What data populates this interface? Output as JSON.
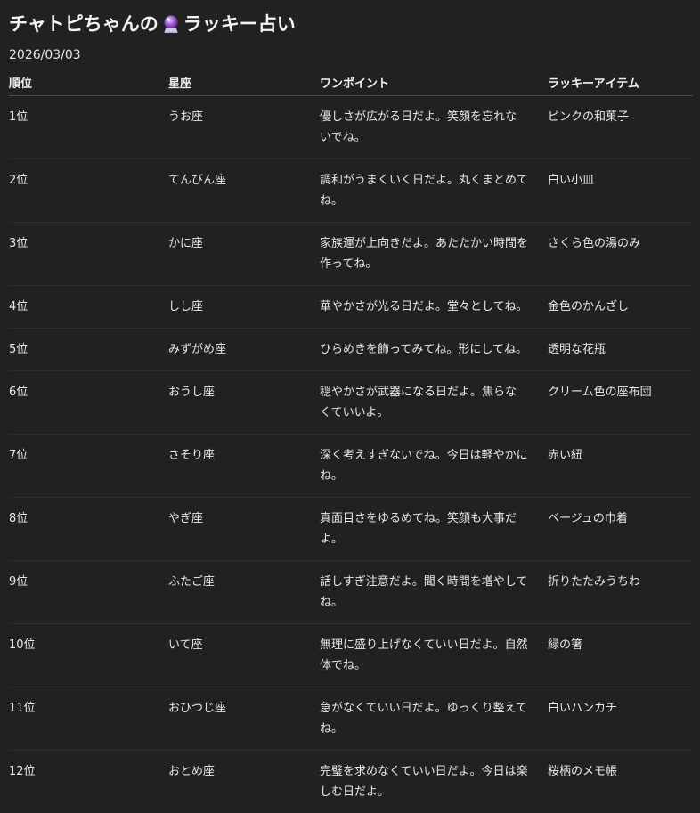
{
  "title": {
    "prefix": "チャトピちゃんの",
    "icon": "crystal-ball-icon",
    "suffix": "ラッキー占い"
  },
  "date": "2026/03/03",
  "table": {
    "headers": [
      "順位",
      "星座",
      "ワンポイント",
      "ラッキーアイテム"
    ],
    "rows": [
      {
        "rank": "1位",
        "sign": "うお座",
        "tip": "優しさが広がる日だよ。笑顔を忘れないでね。",
        "item": "ピンクの和菓子"
      },
      {
        "rank": "2位",
        "sign": "てんびん座",
        "tip": "調和がうまくいく日だよ。丸くまとめてね。",
        "item": "白い小皿"
      },
      {
        "rank": "3位",
        "sign": "かに座",
        "tip": "家族運が上向きだよ。あたたかい時間を作ってね。",
        "item": "さくら色の湯のみ"
      },
      {
        "rank": "4位",
        "sign": "しし座",
        "tip": "華やかさが光る日だよ。堂々としてね。",
        "item": "金色のかんざし"
      },
      {
        "rank": "5位",
        "sign": "みずがめ座",
        "tip": "ひらめきを飾ってみてね。形にしてね。",
        "item": "透明な花瓶"
      },
      {
        "rank": "6位",
        "sign": "おうし座",
        "tip": "穏やかさが武器になる日だよ。焦らなくていいよ。",
        "item": "クリーム色の座布団"
      },
      {
        "rank": "7位",
        "sign": "さそり座",
        "tip": "深く考えすぎないでね。今日は軽やかにね。",
        "item": "赤い紐"
      },
      {
        "rank": "8位",
        "sign": "やぎ座",
        "tip": "真面目さをゆるめてね。笑顔も大事だよ。",
        "item": "ベージュの巾着"
      },
      {
        "rank": "9位",
        "sign": "ふたご座",
        "tip": "話しすぎ注意だよ。聞く時間を増やしてね。",
        "item": "折りたたみうちわ"
      },
      {
        "rank": "10位",
        "sign": "いて座",
        "tip": "無理に盛り上げなくていい日だよ。自然体でね。",
        "item": "緑の箸"
      },
      {
        "rank": "11位",
        "sign": "おひつじ座",
        "tip": "急がなくていい日だよ。ゆっくり整えてね。",
        "item": "白いハンカチ"
      },
      {
        "rank": "12位",
        "sign": "おとめ座",
        "tip": "完璧を求めなくていい日だよ。今日は楽しむ日だよ。",
        "item": "桜柄のメモ帳"
      }
    ]
  }
}
